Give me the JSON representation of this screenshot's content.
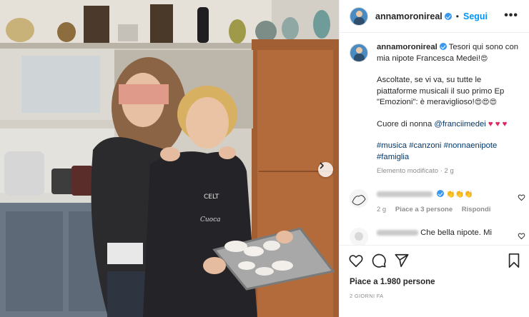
{
  "header": {
    "username": "annamoronireal",
    "separator": "•",
    "follow_label": "Segui",
    "more_label": "•••"
  },
  "caption": {
    "username": "annamoronireal",
    "line1": "Tesori qui sono con mia nipote Francesca Medei!",
    "line2": "Ascoltate, se vi va, su tutte le piattaforme musicali il suo primo Ep \"Emozioni\": è meraviglioso!",
    "line3_prefix": "Cuore di nonna ",
    "mention": "@franciimedei",
    "hashtags": "#musica #canzoni #nonnaenipote #famiglia",
    "edited": "Elemento modificato",
    "edited_sep": " · ",
    "edited_time": "2 g"
  },
  "comments": [
    {
      "time": "2 g",
      "likes": "Piace a 3 persone",
      "reply": "Rispondi"
    },
    {
      "text": "Che bella nipote. Mi"
    }
  ],
  "footer": {
    "likes": "Piace a 1.980 persone",
    "date": "2 GIORNI FA"
  },
  "icons": {
    "like": "heart-icon",
    "comment": "comment-icon",
    "share": "share-icon",
    "save": "bookmark-icon",
    "next": "chevron-right-icon",
    "verified": "verified-badge-icon"
  },
  "colors": {
    "link": "#0095f6",
    "verified": "#3897f0",
    "hashtag": "#00376b",
    "muted": "#8e8e8e",
    "heart_red": "#e0245e"
  }
}
